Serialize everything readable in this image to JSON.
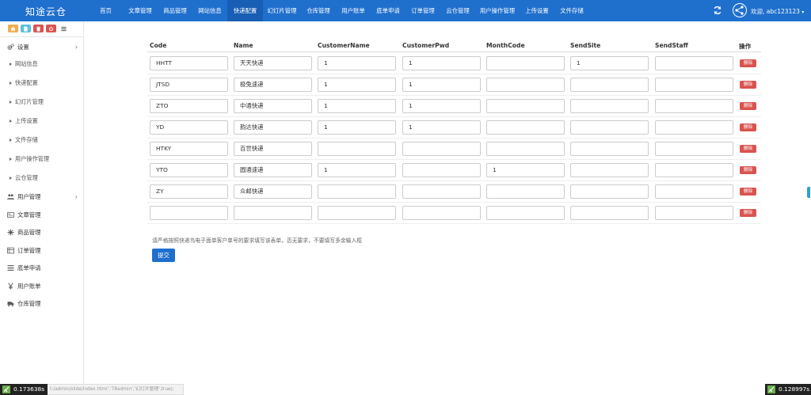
{
  "app": {
    "brand": "知途云仓"
  },
  "topnav": {
    "items": [
      {
        "label": "首页",
        "active": false
      },
      {
        "label": "文章管理",
        "active": false
      },
      {
        "label": "商品管理",
        "active": false
      },
      {
        "label": "网站信息",
        "active": false
      },
      {
        "label": "快递配置",
        "active": true
      },
      {
        "label": "幻灯片管理",
        "active": false
      },
      {
        "label": "仓库管理",
        "active": false
      },
      {
        "label": "用户账单",
        "active": false
      },
      {
        "label": "底单申请",
        "active": false
      },
      {
        "label": "订单管理",
        "active": false
      },
      {
        "label": "云仓管理",
        "active": false
      },
      {
        "label": "用户操作管理",
        "active": false
      },
      {
        "label": "上传设置",
        "active": false
      },
      {
        "label": "文件存储",
        "active": false
      }
    ],
    "user": "欢迎, abc123123",
    "caret": "▾"
  },
  "sidebar": {
    "quick_buttons": [
      {
        "icon": "home-icon",
        "color": "#f0ad4e"
      },
      {
        "icon": "file-icon",
        "color": "#5bc0de"
      },
      {
        "icon": "trash-icon",
        "color": "#d9534f"
      },
      {
        "icon": "power-icon",
        "color": "#d9534f"
      },
      {
        "icon": "list-icon",
        "color": "#ffffff"
      }
    ],
    "settings": {
      "label": "设置",
      "chevron": "›"
    },
    "settings_items": [
      "网站信息",
      "快递配置",
      "幻灯片管理",
      "上传设置",
      "文件存储",
      "用户操作管理",
      "云仓管理"
    ],
    "users": {
      "label": "用户管理",
      "chevron": "›"
    },
    "menus": [
      {
        "label": "文章管理",
        "icon": "article-icon"
      },
      {
        "label": "商品管理",
        "icon": "snowflake-icon"
      },
      {
        "label": "订单管理",
        "icon": "order-icon"
      },
      {
        "label": "底单申请",
        "icon": "menu-icon"
      },
      {
        "label": "用户账单",
        "icon": "yen-icon"
      },
      {
        "label": "仓库管理",
        "icon": "truck-icon"
      }
    ]
  },
  "table": {
    "headers": [
      "Code",
      "Name",
      "CustomerName",
      "CustomerPwd",
      "MonthCode",
      "SendSite",
      "SendStaff",
      "操作"
    ],
    "rows": [
      [
        "HHTT",
        "天天快递",
        "1",
        "1",
        "",
        "1",
        ""
      ],
      [
        "JTSD",
        "极兔速递",
        "1",
        "1",
        "",
        "",
        ""
      ],
      [
        "ZTO",
        "中通快递",
        "1",
        "1",
        "",
        "",
        ""
      ],
      [
        "YD",
        "韵达快递",
        "1",
        "1",
        "",
        "",
        ""
      ],
      [
        "HTKY",
        "百世快递",
        "",
        "",
        "",
        "",
        ""
      ],
      [
        "YTO",
        "圆通速递",
        "1",
        "",
        "1",
        "",
        ""
      ],
      [
        "ZY",
        "众邮快递",
        "",
        "",
        "",
        "",
        ""
      ],
      [
        "",
        "",
        "",
        "",
        "",
        "",
        ""
      ]
    ],
    "delete_label": "删除"
  },
  "note": "请严格按照快递鸟电子面单客户单号的要求填写该表单，否无要求，不要填写多余输入框",
  "submit_label": "提交",
  "status": {
    "url": "t:/admin/slide/index.html','78admin','幻灯片管理',true);",
    "left_timer": "0.173638s",
    "right_timer": "0.128997s"
  },
  "colors": {
    "topbar": "#1f6fcd",
    "active_nav": "#185eb4",
    "danger": "#d9534f",
    "primary": "#1f6fcd"
  }
}
